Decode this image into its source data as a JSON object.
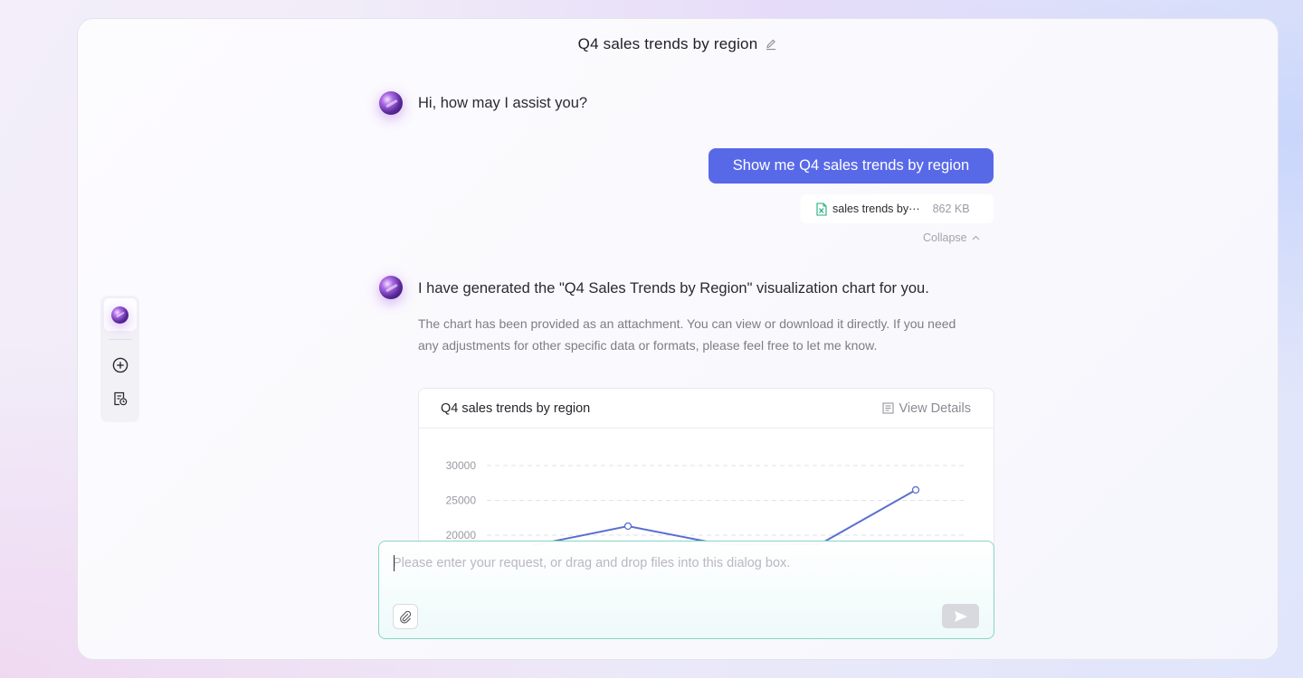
{
  "conversation": {
    "title": "Q4 sales trends by region",
    "edit_icon": "edit-pencil-icon"
  },
  "toolbar": {
    "items": [
      {
        "name": "assistant-avatar",
        "icon": "orb-avatar-icon"
      },
      {
        "name": "new-chat",
        "icon": "plus-circle-icon"
      },
      {
        "name": "history",
        "icon": "document-clock-icon"
      }
    ]
  },
  "messages": {
    "greeting": "Hi, how may I assist you?",
    "user_request": "Show me Q4 sales trends by region",
    "attachment": {
      "name": "sales trends by···",
      "size": "862 KB",
      "icon": "excel-file-icon"
    },
    "collapse_label": "Collapse",
    "response_title": "I have generated the \"Q4 Sales Trends by Region\" visualization chart for you.",
    "response_body": "The chart has been provided as an attachment. You can view or download it directly. If you need any adjustments for other specific data or formats, please feel free to let me know."
  },
  "chart_card": {
    "title": "Q4 sales trends by region",
    "view_details_label": "View Details",
    "chart_data": {
      "type": "line",
      "title": "Q4 sales trends by region",
      "y_ticks": [
        30000,
        25000,
        20000
      ],
      "ylim": [
        0,
        30000
      ],
      "grid": true,
      "series": [
        {
          "color": "#5a6fd0",
          "points": [
            {
              "x": 1,
              "y": 18500
            },
            {
              "x": 2,
              "y": 21300
            },
            {
              "x": 3,
              "y": 18600
            },
            {
              "x": 4,
              "y": 18700
            },
            {
              "x": 5,
              "y": 26500
            }
          ]
        }
      ]
    }
  },
  "composer": {
    "placeholder": "Please enter your request, or drag and drop files into this dialog box.",
    "value": ""
  },
  "colors": {
    "accent": "#5869e8",
    "input_border": "#86d6c4",
    "line": "#5a6fd0"
  }
}
